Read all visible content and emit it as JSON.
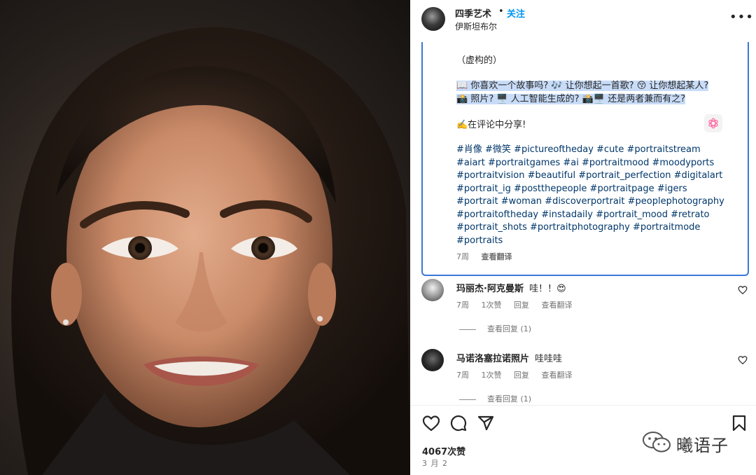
{
  "post": {
    "username": "四季艺术",
    "separator": "•",
    "follow_label": "关注",
    "location": "伊斯坦布尔",
    "more_icon": "more-horizontal-icon"
  },
  "caption": {
    "fictional_note": "（虚构的）",
    "question_line1": "📖 你喜欢一个故事吗? 🎶 让你想起一首歌? 😚 让你想起某人?",
    "question_line2": "📸 照片? 🖥️ 人工智能生成的? 📸🖥️ 还是两者兼而有之?",
    "share_line": "✍️在评论中分享!",
    "hashtags": "#肖像 #微笑 #pictureoftheday #cute #portraitstream #aiart #portraitgames #ai #portraitmood #moodyports #portraitvision #beautiful #portrait_perfection #digitalart #portrait_ig #postthepeople #portraitpage #igers #portrait #woman #discoverportrait #peoplephotography #portraitoftheday #instadaily #portrait_mood #retrato #portrait_shots #portraitphotography #portraitmode #portraits",
    "time": "7周",
    "translate_label": "查看翻译",
    "ai_icon": "openai-logo-icon"
  },
  "comments": [
    {
      "author": "玛丽杰·阿克曼斯",
      "text": "哇！！😍",
      "time": "7周",
      "likes": "1次赞",
      "reply_label": "回复",
      "translate_label": "查看翻译",
      "view_replies": "查看回复 (1)"
    },
    {
      "author": "马诺洛塞拉诺照片",
      "text": "哇哇哇",
      "time": "7周",
      "likes": "1次赞",
      "reply_label": "回复",
      "translate_label": "查看翻译",
      "view_replies": "查看回复 (1)"
    }
  ],
  "footer": {
    "like_count": "4067次赞",
    "date": "3 月 2"
  },
  "watermark": {
    "text": "曦语子"
  },
  "colors": {
    "follow": "#0095f6",
    "hashtag": "#00376b",
    "highlight": "#c8dcf8",
    "selection_border": "#3b78d8"
  }
}
